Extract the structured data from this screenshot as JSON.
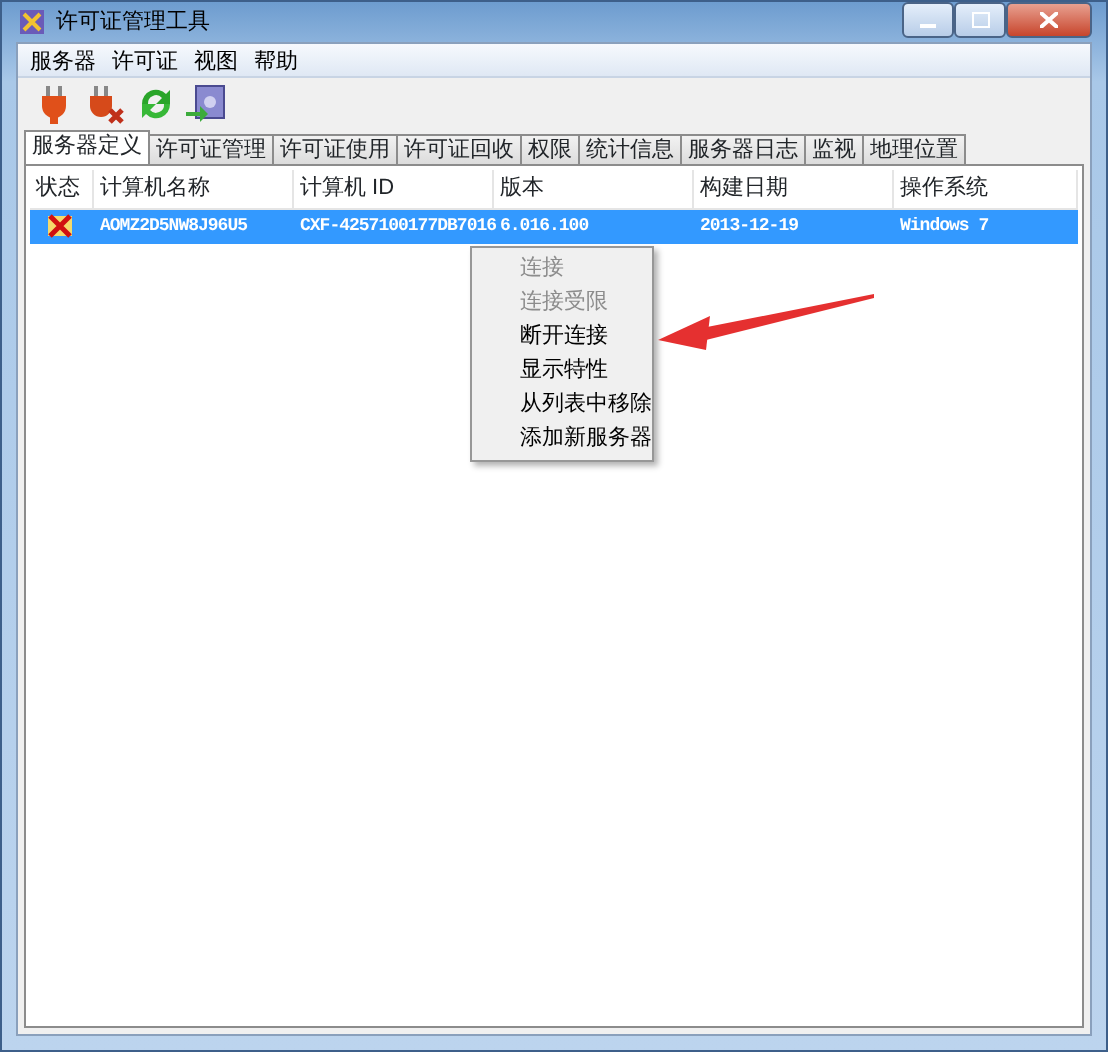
{
  "window": {
    "title": "许可证管理工具"
  },
  "menu_bar": [
    "服务器",
    "许可证",
    "视图",
    "帮助"
  ],
  "toolbar": [
    {
      "kind": "plug"
    },
    {
      "kind": "unplug"
    },
    {
      "kind": "refresh"
    },
    {
      "kind": "import"
    }
  ],
  "tabs": [
    {
      "label": "服务器定义",
      "selected": true
    },
    {
      "label": "许可证管理",
      "selected": false
    },
    {
      "label": "许可证使用",
      "selected": false
    },
    {
      "label": "许可证回收",
      "selected": false
    },
    {
      "label": "权限",
      "selected": false
    },
    {
      "label": "统计信息",
      "selected": false
    },
    {
      "label": "服务器日志",
      "selected": false
    },
    {
      "label": "监视",
      "selected": false
    },
    {
      "label": "地理位置",
      "selected": false
    }
  ],
  "table": {
    "columns": [
      "状态",
      "计算机名称",
      "计算机 ID",
      "版本",
      "构建日期",
      "操作系统"
    ],
    "rows": [
      {
        "selected": true,
        "error": true,
        "cells": [
          "",
          "AOMZ2D5NW8J96U5",
          "CXF-4257100177DB7016",
          "6.016.100",
          "2013-12-19",
          "Windows 7"
        ]
      }
    ]
  },
  "context_menu": [
    {
      "label": "连接",
      "disabled": true
    },
    {
      "label": "连接受限",
      "disabled": true
    },
    {
      "label": "断开连接",
      "disabled": false
    },
    {
      "label": "显示特性",
      "disabled": false
    },
    {
      "label": "从列表中移除",
      "disabled": false
    },
    {
      "label": "添加新服务器",
      "disabled": false
    }
  ]
}
